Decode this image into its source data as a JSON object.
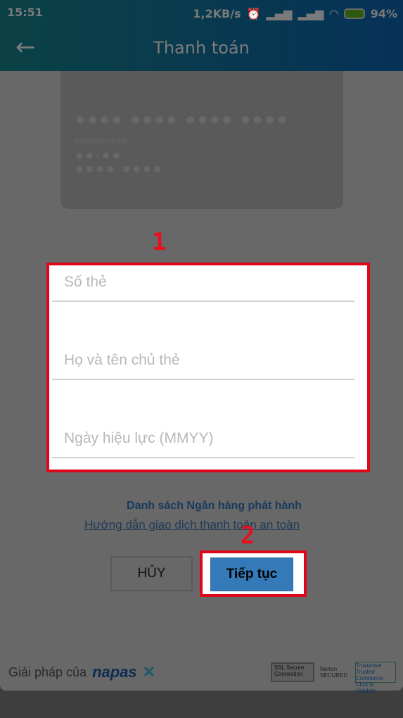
{
  "status_bar": {
    "time": "15:51",
    "net_speed": "1,2KB/s",
    "battery": "94%",
    "icons": [
      "alarm-icon",
      "signal-icon",
      "signal-icon",
      "wifi-icon",
      "battery-charging-icon"
    ]
  },
  "header": {
    "title": "Thanh toán",
    "back_icon": "arrow-left-icon"
  },
  "card_preview": {
    "number_mask": "●●●● ●●●● ●●●● ●●●●",
    "expiry_label": "MONTH/YEAR",
    "expiry_mask": "●●/●●",
    "name_mask": "●●●● ●●●●"
  },
  "annotations": {
    "step1": "1",
    "step2": "2",
    "highlight_color": "#e0061a"
  },
  "form": {
    "card_number": {
      "placeholder": "Số thẻ",
      "value": ""
    },
    "holder_name": {
      "placeholder": "Họ và tên chủ thẻ",
      "value": ""
    },
    "valid_from": {
      "placeholder": "Ngày hiệu lực (MMYY)",
      "value": ""
    }
  },
  "links": {
    "banks": "Danh sách Ngân hàng phát hành",
    "guide": "Hướng dẫn giao dịch thanh toán an toàn"
  },
  "buttons": {
    "cancel": "HỦY",
    "continue": "Tiếp tục",
    "continue_color": "#347ab8"
  },
  "footer": {
    "powered_by": "Giải pháp của",
    "brand": "napas",
    "badges": {
      "ssl": "SSL Secure Connection",
      "norton": "Norton SECURED",
      "trustwave": "Trustwave Trusted Commerce Click to Validate"
    }
  }
}
